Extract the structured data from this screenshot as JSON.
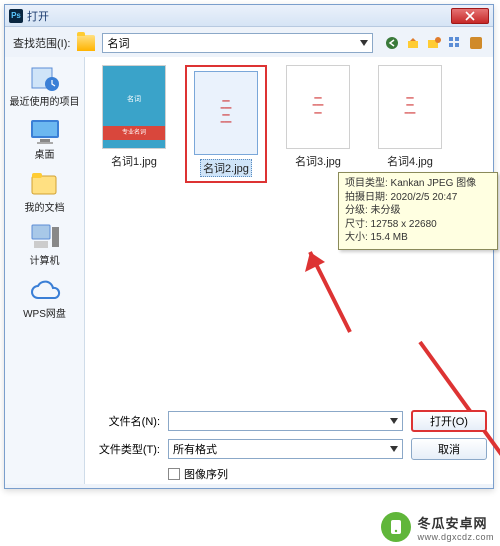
{
  "title": "打开",
  "lookin_label": "查找范围(I):",
  "lookin_value": "名词",
  "places": [
    {
      "label": "最近使用的项目"
    },
    {
      "label": "桌面"
    },
    {
      "label": "我的文档"
    },
    {
      "label": "计算机"
    },
    {
      "label": "WPS网盘"
    }
  ],
  "files": [
    {
      "caption": "名词1.jpg",
      "band": "专业名词",
      "tag": "名词"
    },
    {
      "caption": "名词2.jpg"
    },
    {
      "caption": "名词3.jpg"
    },
    {
      "caption": "名词4.jpg"
    }
  ],
  "tooltip": {
    "l1": "项目类型: Kankan JPEG 图像",
    "l2": "拍摄日期: 2020/2/5 20:47",
    "l3": "分级: 未分级",
    "l4": "尺寸: 12758 x 22680",
    "l5": "大小: 15.4 MB"
  },
  "filename_label": "文件名(N):",
  "filename_value": "",
  "filetype_label": "文件类型(T):",
  "filetype_value": "所有格式",
  "open_btn": "打开(O)",
  "cancel_btn": "取消",
  "sequence_label": "图像序列",
  "watermark": {
    "name": "冬瓜安卓网",
    "url": "www.dgxcdz.com"
  }
}
